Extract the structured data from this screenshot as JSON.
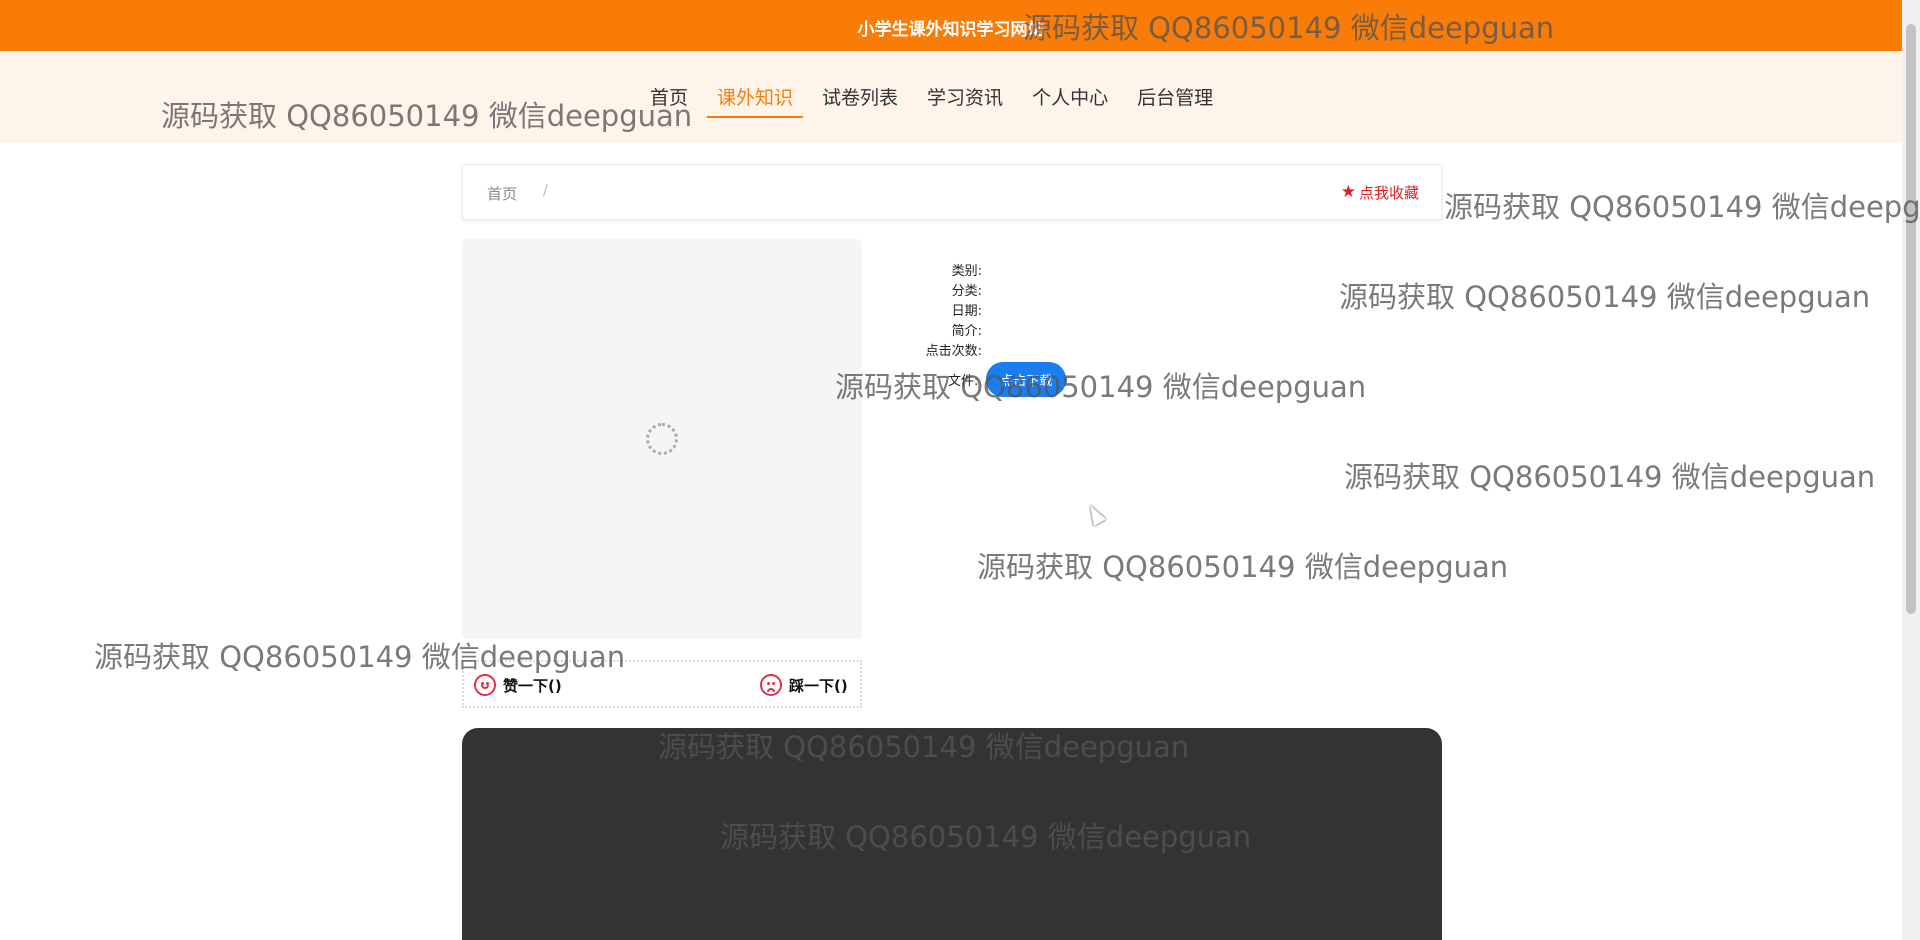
{
  "header": {
    "site_title": "小学生课外知识学习网站"
  },
  "nav": {
    "items": [
      {
        "label": "首页"
      },
      {
        "label": "课外知识"
      },
      {
        "label": "试卷列表"
      },
      {
        "label": "学习资讯"
      },
      {
        "label": "个人中心"
      },
      {
        "label": "后台管理"
      }
    ],
    "active": "课外知识"
  },
  "breadcrumb": {
    "home": "首页",
    "separator": "/",
    "favorite_label": "点我收藏"
  },
  "details": {
    "category": "类别:",
    "classification": "分类:",
    "date": "日期:",
    "intro": "简介:",
    "clicks": "点击次数:",
    "file": "文件:",
    "download_label": "点击下载"
  },
  "votes": {
    "like_label": "赞一下()",
    "dislike_label": "踩一下()"
  },
  "watermark": {
    "text": "源码获取 QQ86050149 微信deepguan"
  },
  "colors": {
    "brand": "#fa7c08",
    "nav_bg": "#fff4ea",
    "download": "#1a7ef0",
    "favorite": "#e02020",
    "panel_dark": "#333333"
  }
}
